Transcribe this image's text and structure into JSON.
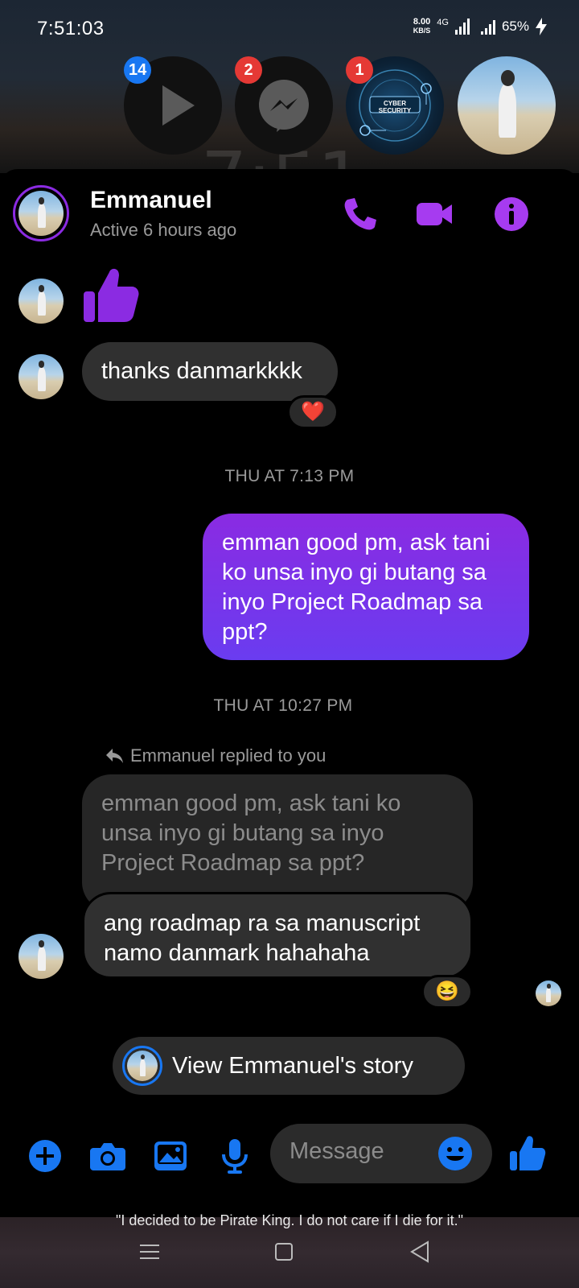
{
  "status_bar": {
    "time": "7:51:03",
    "net_speed_value": "8.00",
    "net_speed_unit": "KB/S",
    "network_type": "4G",
    "battery": "65%"
  },
  "wallpaper": {
    "clock": "7:51"
  },
  "chat_heads": [
    {
      "name": "video-app-head",
      "badge": "14",
      "badge_color": "#1877f2"
    },
    {
      "name": "messenger-head",
      "badge": "2",
      "badge_color": "#e53935"
    },
    {
      "name": "cyber-security-head",
      "badge": "1",
      "badge_color": "#e53935",
      "label": "CYBER SECURITY"
    },
    {
      "name": "emmanuel-head",
      "badge": ""
    }
  ],
  "header": {
    "name": "Emmanuel",
    "status": "Active 6 hours ago"
  },
  "messages": {
    "msg1_thanks": "thanks danmarkkkk",
    "msg1_reaction": "❤️",
    "ts1": "THU AT 7:13 PM",
    "msg2_out": "emman good pm, ask tani ko unsa inyo gi butang sa inyo Project Roadmap sa ppt?",
    "ts2": "THU AT 10:27 PM",
    "replied_label": "Emmanuel replied to you",
    "quoted": "emman good pm, ask tani ko unsa inyo gi butang sa inyo Project Roadmap sa ppt?",
    "msg3_reply": "ang roadmap ra sa manuscript namo danmark hahahaha",
    "msg3_reaction": "😆"
  },
  "story_button": {
    "label": "View Emmanuel's story"
  },
  "composer": {
    "placeholder": "Message"
  },
  "wallpaper_quote": "\"I decided to be Pirate King. I do not care if I die for it.\"",
  "colors": {
    "accent_purple": "#8b2be2",
    "messenger_blue": "#1877f2",
    "bubble_in": "#303030"
  }
}
